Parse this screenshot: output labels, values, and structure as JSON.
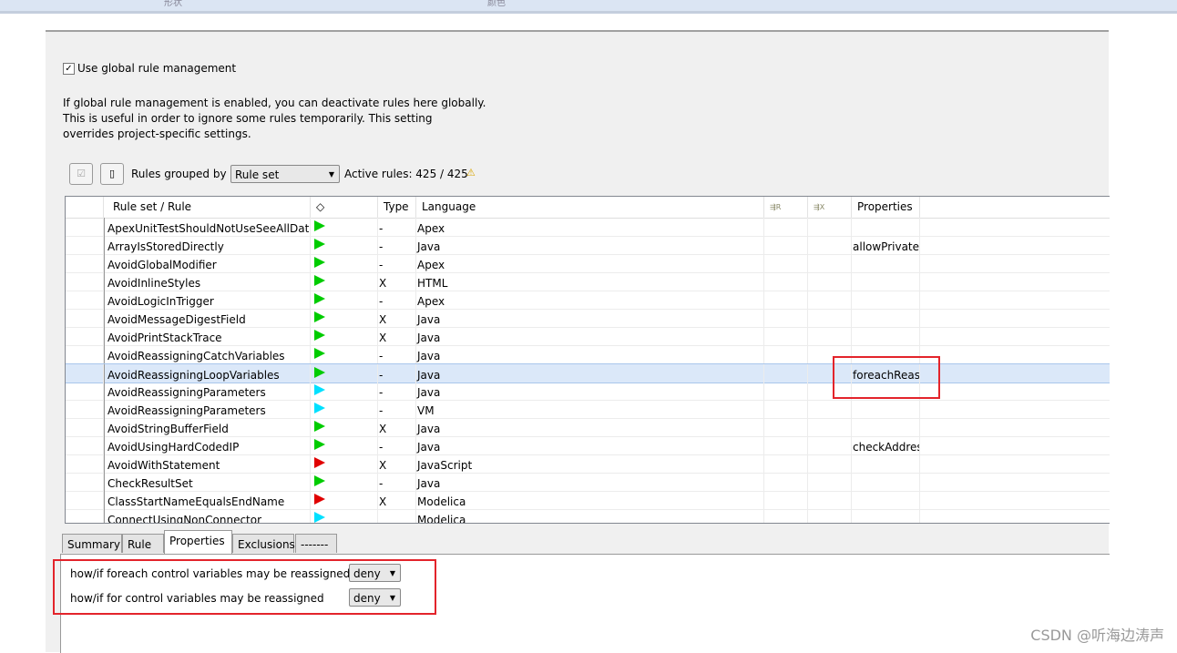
{
  "topbar": {
    "labels": [
      "形状",
      "颜色"
    ]
  },
  "global": {
    "checkbox_label": "Use global rule management",
    "checked": true,
    "description": [
      "If global rule management is enabled, you can deactivate rules here globally.",
      "This is useful in order to ignore some rules temporarily. This setting",
      "overrides project-specific settings."
    ]
  },
  "toolbar": {
    "grouped_label": "Rules grouped by",
    "grouped_value": "Rule set",
    "active_rules": "Active rules: 425 / 425"
  },
  "table": {
    "headers": [
      "Rule set / Rule",
      "◇",
      "Type",
      "Language",
      "R",
      "X",
      "Properties"
    ],
    "rows": [
      {
        "rule": "ApexUnitTestShouldNotUseSeeAllData",
        "priority": "#00cc00",
        "type": "-",
        "language": "Apex",
        "props": ""
      },
      {
        "rule": "ArrayIsStoredDirectly",
        "priority": "#00cc00",
        "type": "-",
        "language": "Java",
        "props": "allowPrivate:"
      },
      {
        "rule": "AvoidGlobalModifier",
        "priority": "#00cc00",
        "type": "-",
        "language": "Apex",
        "props": ""
      },
      {
        "rule": "AvoidInlineStyles",
        "priority": "#00cc00",
        "type": "X",
        "language": "HTML",
        "props": ""
      },
      {
        "rule": "AvoidLogicInTrigger",
        "priority": "#00cc00",
        "type": "-",
        "language": "Apex",
        "props": ""
      },
      {
        "rule": "AvoidMessageDigestField",
        "priority": "#00cc00",
        "type": "X",
        "language": "Java",
        "props": ""
      },
      {
        "rule": "AvoidPrintStackTrace",
        "priority": "#00cc00",
        "type": "X",
        "language": "Java",
        "props": ""
      },
      {
        "rule": "AvoidReassigningCatchVariables",
        "priority": "#00cc00",
        "type": "-",
        "language": "Java",
        "props": ""
      },
      {
        "rule": "AvoidReassigningLoopVariables",
        "priority": "#00cc00",
        "type": "-",
        "language": "Java",
        "props": "foreachReass",
        "selected": true
      },
      {
        "rule": "AvoidReassigningParameters",
        "priority": "#00e0ff",
        "type": "-",
        "language": "Java",
        "props": ""
      },
      {
        "rule": "AvoidReassigningParameters",
        "priority": "#00e0ff",
        "type": "-",
        "language": "VM",
        "props": ""
      },
      {
        "rule": "AvoidStringBufferField",
        "priority": "#00cc00",
        "type": "X",
        "language": "Java",
        "props": ""
      },
      {
        "rule": "AvoidUsingHardCodedIP",
        "priority": "#00cc00",
        "type": "-",
        "language": "Java",
        "props": "checkAddres"
      },
      {
        "rule": "AvoidWithStatement",
        "priority": "#e00000",
        "type": "X",
        "language": "JavaScript",
        "props": ""
      },
      {
        "rule": "CheckResultSet",
        "priority": "#00cc00",
        "type": "-",
        "language": "Java",
        "props": ""
      },
      {
        "rule": "ClassStartNameEqualsEndName",
        "priority": "#e00000",
        "type": "X",
        "language": "Modelica",
        "props": ""
      },
      {
        "rule": "ConnectUsingNonConnector",
        "priority": "#00e0ff",
        "type": "",
        "language": "Modelica",
        "props": ""
      }
    ]
  },
  "tabs": [
    "Summary",
    "Rule",
    "Properties",
    "Exclusions",
    "-------"
  ],
  "active_tab": "Properties",
  "properties": [
    {
      "label": "how/if foreach control variables may be reassigned",
      "value": "deny"
    },
    {
      "label": "how/if for control variables may be reassigned",
      "value": "deny"
    }
  ],
  "watermark": "CSDN @听海边涛声"
}
